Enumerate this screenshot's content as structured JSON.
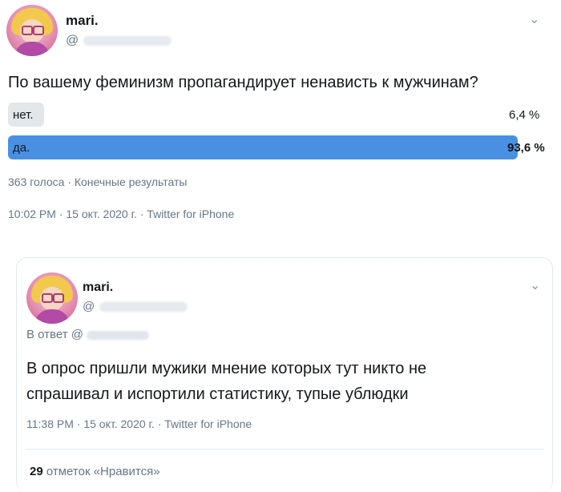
{
  "main_tweet": {
    "author_name": "mari.",
    "handle_prefix": "@",
    "question": "По вашему феминизм пропагандирует ненависть к мужчинам?",
    "poll": [
      {
        "label": "нет.",
        "percent_text": "6,4 %",
        "fraction": 0.064,
        "winner": false
      },
      {
        "label": "да.",
        "percent_text": "93,6 %",
        "fraction": 0.936,
        "winner": true
      }
    ],
    "poll_summary": "363 голоса · Конечные результаты",
    "timestamp": "10:02 PM · 15 окт. 2020 г. · Twitter for iPhone"
  },
  "quoted_tweet": {
    "author_name": "mari.",
    "handle_prefix": "@",
    "reply_prefix": "В ответ @",
    "text_line1": "В опрос пришли мужики мнение которых тут никто не",
    "text_line2": "спрашивал и испортили статистику, тупые ублюдки",
    "timestamp": "11:38 PM · 15 окт. 2020 г. · Twitter for iPhone",
    "likes_count": "29",
    "likes_label": "отметок «Нравится»"
  },
  "colors": {
    "winner_bar": "#4a90e2",
    "loser_bar": "#e4e7ea",
    "secondary_text": "#657786"
  },
  "icons": {
    "more": "chevron-down-icon"
  }
}
